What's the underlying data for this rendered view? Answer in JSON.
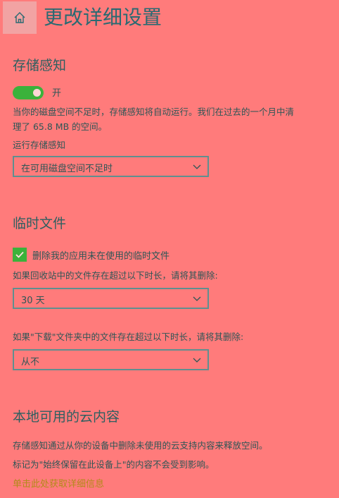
{
  "header": {
    "title": "更改详细设置",
    "home_icon": "home-icon"
  },
  "storage_sense": {
    "title": "存储感知",
    "toggle_state": "开",
    "toggle_on": true,
    "description_line1": "当你的磁盘空间不足时，存储感知将自动运行。我们在过去的一个月中清",
    "description_line2": "理了 65.8 MB 的空间。",
    "run_label": "运行存储感知",
    "run_value": "在可用磁盘空间不足时"
  },
  "temp_files": {
    "title": "临时文件",
    "checkbox_label": "删除我的应用未在使用的临时文件",
    "checkbox_checked": true,
    "recycle_label": "如果回收站中的文件存在超过以下时长，请将其删除:",
    "recycle_value": "30 天",
    "downloads_label": "如果\"下载\"文件夹中的文件存在超过以下时长，请将其删除:",
    "downloads_value": "从不"
  },
  "cloud": {
    "title": "本地可用的云内容",
    "desc1": "存储感知通过从你的设备中删除未使用的云支持内容来释放空间。",
    "desc2": "标记为\"始终保留在此设备上\"的内容不会受到影响。",
    "link": "单击此处获取详细信息"
  },
  "colors": {
    "background": "#ff7b7b",
    "accent_green": "#3bb23b",
    "link_color": "#b38a1a"
  }
}
